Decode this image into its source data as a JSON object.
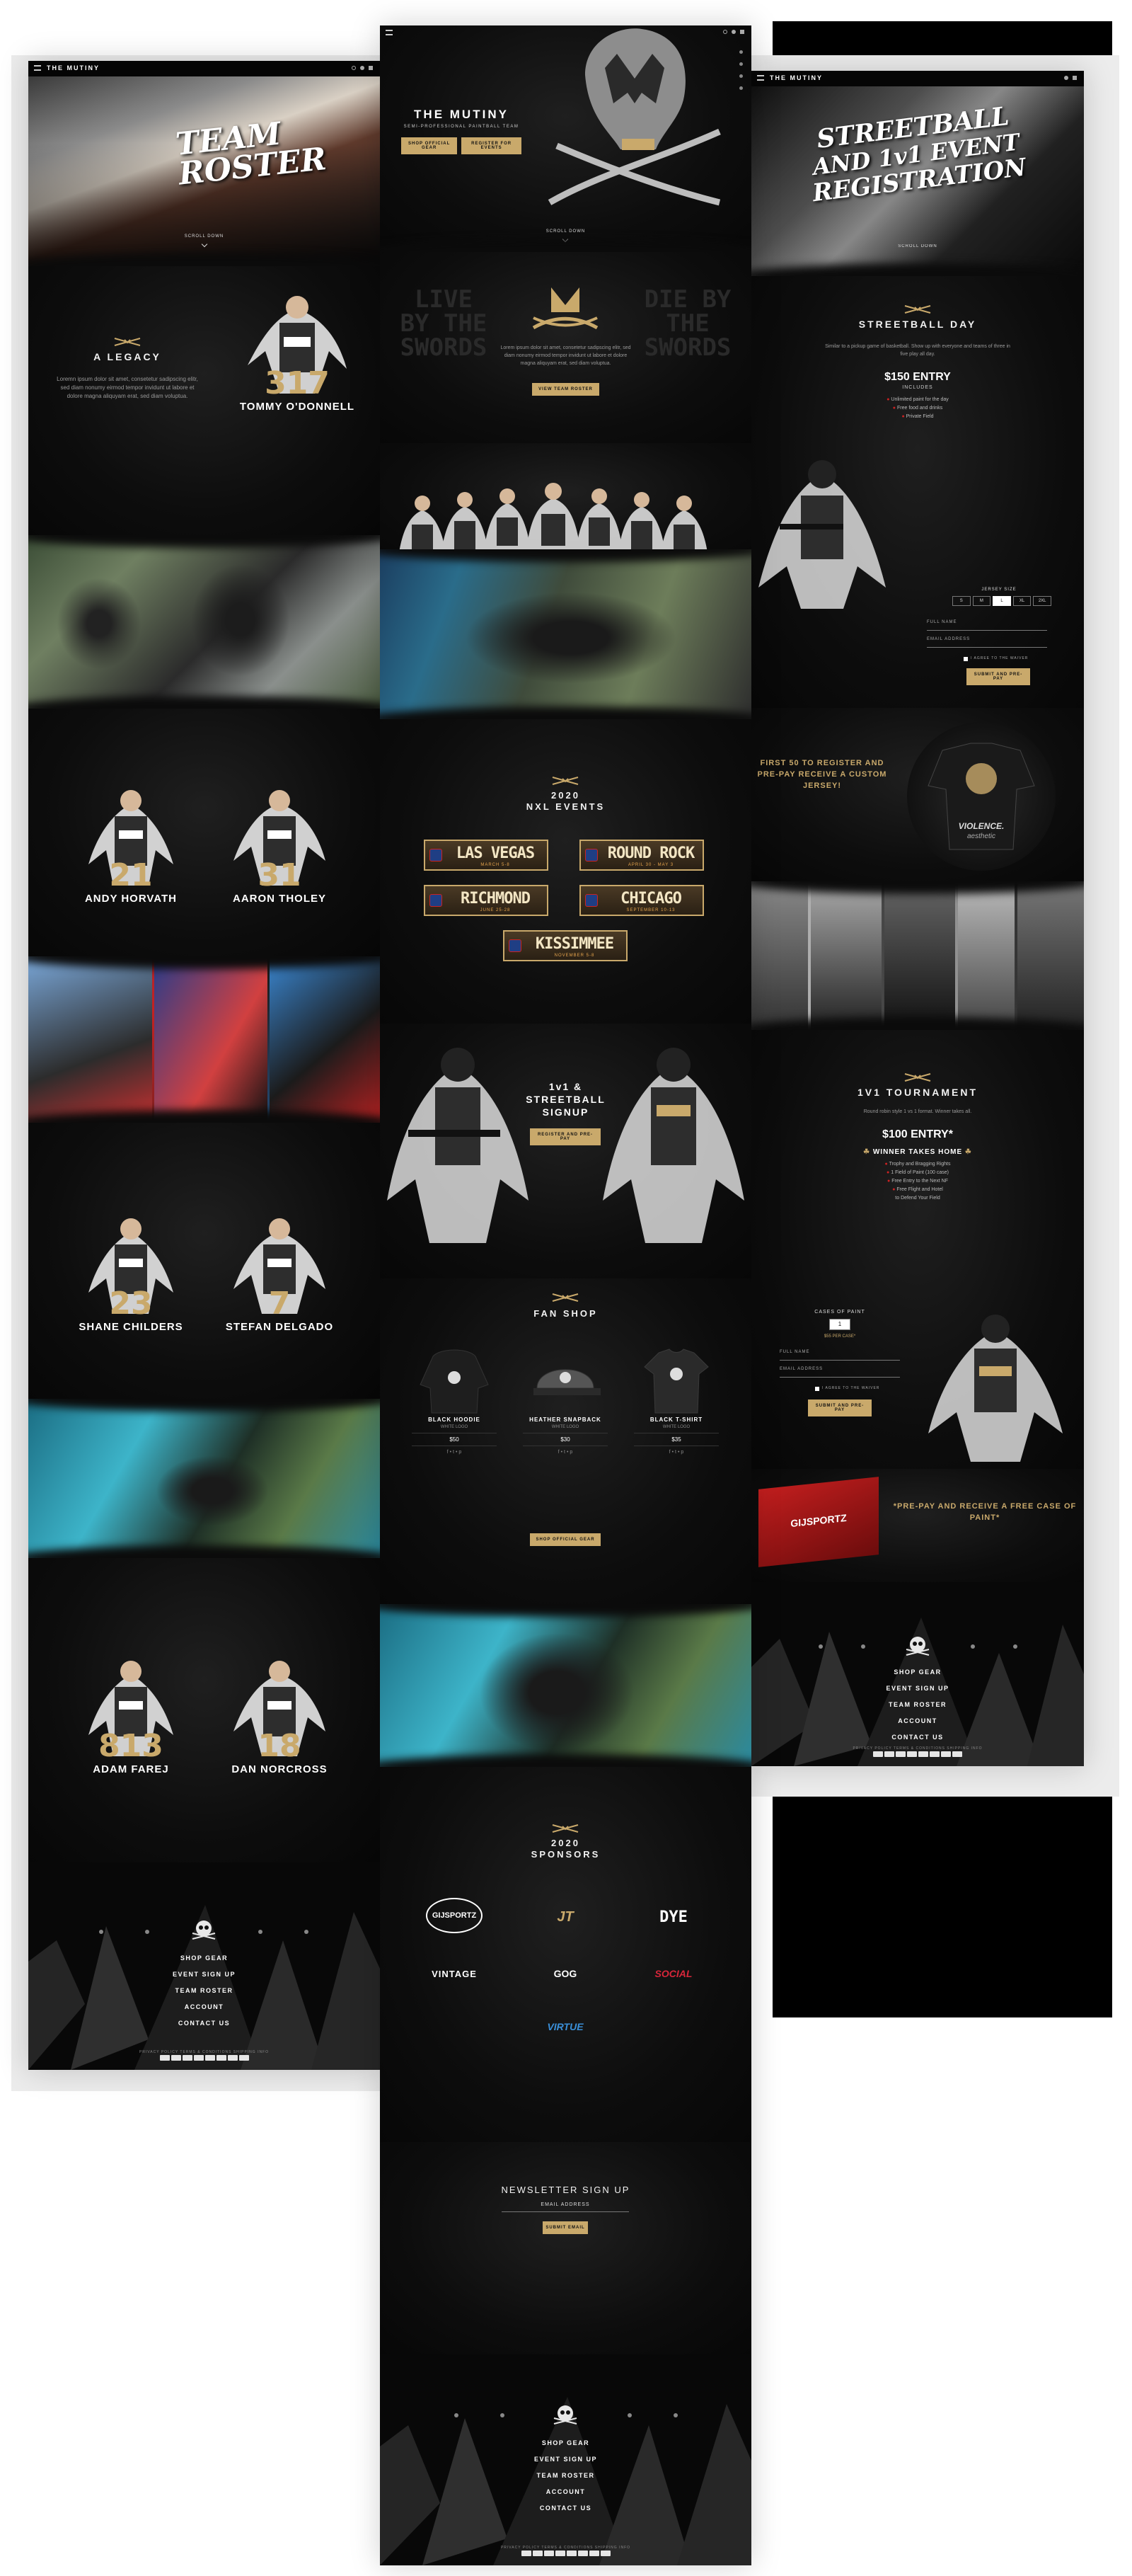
{
  "brand": {
    "name": "THE MUTINY",
    "tagline": "SEMI-PROFESSIONAL PAINTBALL TEAM",
    "accent": "#c9a96b"
  },
  "roster": {
    "hero_title_line1": "TEAM",
    "hero_title_line2": "ROSTER",
    "scroll_down": "SCROLL DOWN",
    "legacy_title": "A LEGACY",
    "legacy_text": "Loremn ipsum dolor sit amet, consetetur sadipscing elitr, sed diam nonumy eirmod tempor invidunt ut labore et dolore magna aliquyam erat, sed diam voluptua.",
    "players": [
      {
        "number": "317",
        "name": "TOMMY O'DONNELL"
      },
      {
        "number": "21",
        "name": "ANDY HORVATH"
      },
      {
        "number": "31",
        "name": "AARON THOLEY"
      },
      {
        "number": "23",
        "name": "SHANE CHILDERS"
      },
      {
        "number": "7",
        "name": "STEFAN DELGADO"
      },
      {
        "number": "813",
        "name": "ADAM FAREJ"
      },
      {
        "number": "18",
        "name": "DAN NORCROSS"
      }
    ]
  },
  "home": {
    "shop_button": "SHOP OFFICIAL GEAR",
    "register_button": "REGISTER FOR EVENTS",
    "scroll_down": "SCROLL DOWN",
    "motto_left": "LIVE BY THE SWORDS",
    "motto_right": "DIE BY THE SWORDS",
    "motto_text": "Lorem ipsum dolor sit amet, consetetur sadipscing elitr, sed diam nonumy eirmod tempor invidunt ut labore et dolore magna aliquyam erat, sed diam voluptua.",
    "roster_button": "VIEW TEAM ROSTER",
    "events_year": "2020",
    "events_title": "NXL EVENTS",
    "events": [
      {
        "name": "LAS VEGAS",
        "date": "MARCH 5-8"
      },
      {
        "name": "ROUND ROCK",
        "date": "APRIL 30 - MAY 3"
      },
      {
        "name": "RICHMOND",
        "date": "JUNE 25-28"
      },
      {
        "name": "CHICAGO",
        "date": "SEPTEMBER 10-13"
      },
      {
        "name": "KISSIMMEE",
        "date": "NOVEMBER 5-8"
      }
    ],
    "signup_line1": "1v1 &",
    "signup_line2": "STREETBALL",
    "signup_line3": "SIGNUP",
    "signup_button": "REGISTER AND PRE-PAY",
    "fan_shop_title": "FAN SHOP",
    "products": [
      {
        "title": "BLACK HOODIE",
        "sub": "WHITE LOGO",
        "price": "$50"
      },
      {
        "title": "HEATHER SNAPBACK",
        "sub": "WHITE LOGO",
        "price": "$30"
      },
      {
        "title": "BLACK T-SHIRT",
        "sub": "WHITE LOGO",
        "price": "$35"
      }
    ],
    "shop_all_button": "SHOP OFFICIAL GEAR",
    "sponsors_year": "2020",
    "sponsors_title": "SPONSORS",
    "sponsors": [
      "GIJSPORTZ",
      "JT",
      "DYE",
      "VINTAGE",
      "GOG",
      "SOCIAL",
      "VIRTUE"
    ],
    "newsletter_title": "NEWSLETTER SIGN UP",
    "newsletter_placeholder": "EMAIL ADDRESS",
    "newsletter_button": "SUBMIT EMAIL"
  },
  "registration": {
    "hero_line1": "STREETBALL",
    "hero_line2": "AND 1v1 EVENT",
    "hero_line3": "REGISTRATION",
    "scroll_down": "SCROLL DOWN",
    "streetball_title": "STREETBALL DAY",
    "streetball_text": "Similar to a pickup game of basketball. Show up with everyone and teams of three in five play all day.",
    "streetball_price": "$150 ENTRY",
    "streetball_includes": "INCLUDES",
    "streetball_items": [
      "Unlimited paint for the day",
      "Free food and drinks",
      "Private Field"
    ],
    "jersey_size_label": "JERSEY SIZE",
    "jersey_sizes": [
      "S",
      "M",
      "L",
      "XL",
      "2XL"
    ],
    "full_name_label": "FULL NAME",
    "email_label": "EMAIL ADDRESS",
    "waiver_label": "I AGREE TO THE WAIVER",
    "submit_button": "SUBMIT AND PRE-PAY",
    "jersey_promo": "FIRST 50 TO REGISTER AND PRE-PAY RECEIVE A CUSTOM JERSEY!",
    "jersey_brand": "VIOLENCE.",
    "jersey_brand2": "aesthetic",
    "tournament_title": "1v1 TOURNAMENT",
    "tournament_text": "Round robin style 1 vs 1 format. Winner takes all.",
    "tournament_price": "$100 ENTRY*",
    "winner_line": "WINNER TAKES HOME",
    "tournament_items": [
      "Trophy and Bragging Rights",
      "1 Field of Paint (100 case)",
      "Free Entry to the Next NF",
      "Free Flight and Hotel",
      "to Defend Your Field"
    ],
    "cases_label": "CASES OF PAINT",
    "cases_value": "1",
    "cases_price": "$55 PER CASE*",
    "paint_promo": "*PRE-PAY AND RECEIVE A FREE CASE OF PAINT*",
    "paint_brand": "GIJSPORTZ"
  },
  "footer": {
    "links": [
      "SHOP GEAR",
      "EVENT SIGN UP",
      "TEAM ROSTER",
      "ACCOUNT",
      "CONTACT US"
    ],
    "legal": "PRIVACY POLICY     TERMS & CONDITIONS     SHIPPING INFO"
  }
}
